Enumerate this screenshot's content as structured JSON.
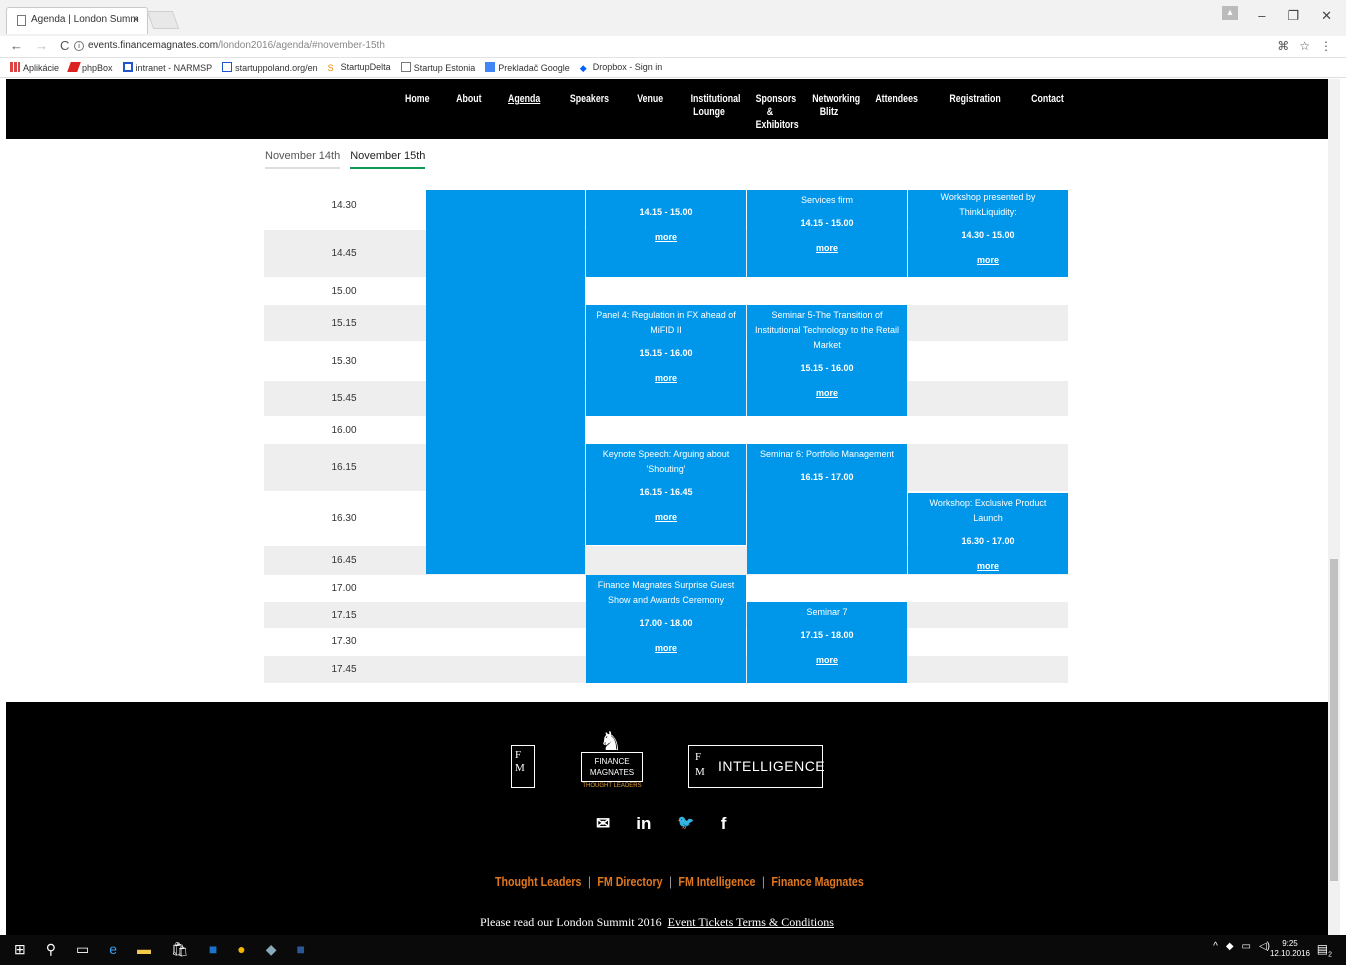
{
  "browser": {
    "tab_title": "Agenda | London Summ",
    "tab_close": "×",
    "url_host": "events.financemagnates.com",
    "url_path": "/london2016/agenda/#november-15th",
    "nav_back": "←",
    "nav_forward": "→",
    "nav_reload": "C",
    "window_minimize": "–",
    "window_restore": "❐",
    "window_close": "✕",
    "bookmarks": [
      "Aplikácie",
      "phpBox",
      "intranet - NARMSP",
      "startuppoland.org/en",
      "StartupDelta",
      "Startup Estonia",
      "Prekladač Google",
      "Dropbox - Sign in"
    ]
  },
  "site_menu": [
    "Home",
    "About",
    "Agenda",
    "Speakers",
    "Venue",
    "Institutional Lounge",
    "Sponsors & Exhibitors",
    "Networking Blitz",
    "Attendees",
    "Registration",
    "Contact"
  ],
  "day_tabs": [
    "November 14th",
    "November 15th"
  ],
  "times": [
    "14.30",
    "14.45",
    "15.00",
    "15.15",
    "15.30",
    "15.45",
    "16.00",
    "16.15",
    "16.30",
    "16.45",
    "17.00",
    "17.15",
    "17.30",
    "17.45"
  ],
  "events": {
    "e1": {
      "title": "",
      "hours": "14.15 - 15.00",
      "more": "more"
    },
    "e2": {
      "title": "Services firm",
      "hours": "14.15 - 15.00",
      "more": "more"
    },
    "e3": {
      "title": "Workshop presented by ThinkLiquidity:",
      "hours": "14.30 - 15.00",
      "more": "more"
    },
    "e4": {
      "title": "Panel 4: Regulation in FX ahead of MiFID II",
      "hours": "15.15 - 16.00",
      "more": "more"
    },
    "e5": {
      "title": "Seminar 5-The Transition of Institutional Technology to the Retail Market",
      "hours": "15.15 - 16.00",
      "more": "more"
    },
    "e6": {
      "title": "Keynote Speech: Arguing about 'Shouting'",
      "hours": "16.15 - 16.45",
      "more": "more"
    },
    "e7": {
      "title": "Seminar 6: Portfolio Management",
      "hours": "16.15 - 17.00",
      "more": ""
    },
    "e8": {
      "title": "Workshop: Exclusive Product Launch",
      "hours": "16.30 - 17.00",
      "more": "more"
    },
    "e9": {
      "title": "Finance Magnates Surprise Guest Show and Awards Ceremony",
      "hours": "17.00 - 18.00",
      "more": "more"
    },
    "e10": {
      "title": "Seminar 7",
      "hours": "17.15 - 18.00",
      "more": "more"
    }
  },
  "footer": {
    "logo_fm": "F\nM",
    "logo_thought_box": "FINANCE MAGNATES",
    "logo_thought_sub": "THOUGHT LEADERS",
    "logo_intel_fm": "F M",
    "logo_intel_word": "INTELLIGENCE",
    "social_icons": [
      "envelope-icon",
      "linkedin-icon",
      "twitter-icon",
      "facebook-icon"
    ],
    "social_glyphs": [
      "✉",
      "in",
      "🐦",
      "f"
    ],
    "links": [
      "Thought Leaders",
      "FM Directory",
      "FM Intelligence",
      "Finance Magnates"
    ],
    "terms_text": "Please read our London Summit 2016",
    "terms_link": "Event Tickets Terms & Conditions"
  },
  "taskbar": {
    "clock_time": "9:25",
    "clock_date": "12.10.2016",
    "notification_count": "2"
  },
  "colors": {
    "event_blue": "#0097ea",
    "header_black": "#000000",
    "active_tab_green": "#0f9b53",
    "footer_link_orange": "#e07820"
  }
}
